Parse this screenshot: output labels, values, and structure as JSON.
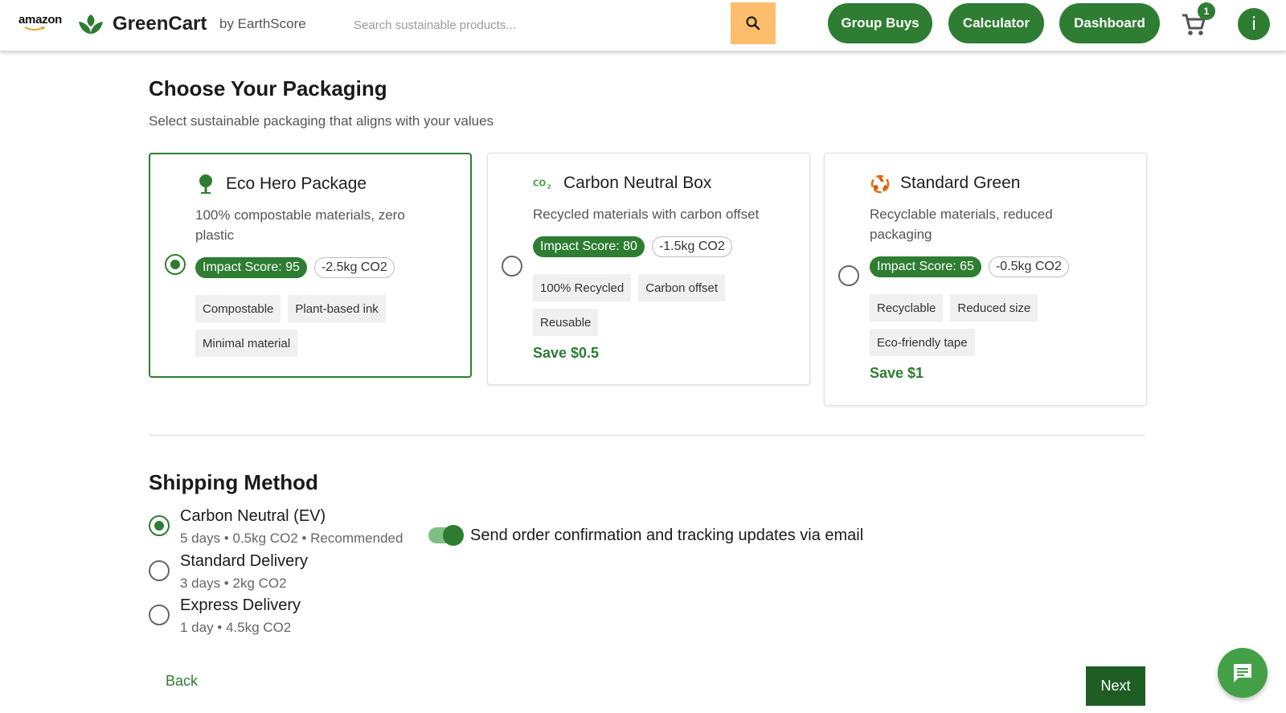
{
  "header": {
    "amazon_label": "amazon",
    "brand": "GreenCart",
    "brand_sub": "by EarthScore",
    "search_placeholder": "Search sustainable products...",
    "nav": [
      "Group Buys",
      "Calculator",
      "Dashboard"
    ],
    "cart_count": "1",
    "avatar_initial": "i"
  },
  "packaging": {
    "title": "Choose Your Packaging",
    "subtitle": "Select sustainable packaging that aligns with your values",
    "options": [
      {
        "icon": "tree-icon",
        "title": "Eco Hero Package",
        "desc": "100% compostable materials, zero plastic",
        "score": "Impact Score: 95",
        "co2": "-2.5kg CO2",
        "tags": [
          "Compostable",
          "Plant-based ink",
          "Minimal material"
        ],
        "save": "",
        "selected": true
      },
      {
        "icon": "co2-icon",
        "title": "Carbon Neutral Box",
        "desc": "Recycled materials with carbon offset",
        "score": "Impact Score: 80",
        "co2": "-1.5kg CO2",
        "tags": [
          "100% Recycled",
          "Carbon offset",
          "Reusable"
        ],
        "save": "Save $0.5",
        "selected": false
      },
      {
        "icon": "recycle-icon",
        "title": "Standard Green",
        "desc": "Recyclable materials, reduced packaging",
        "score": "Impact Score: 65",
        "co2": "-0.5kg CO2",
        "tags": [
          "Recyclable",
          "Reduced size",
          "Eco-friendly tape"
        ],
        "save": "Save $1",
        "selected": false
      }
    ]
  },
  "shipping": {
    "title": "Shipping Method",
    "methods": [
      {
        "label": "Carbon Neutral (EV)",
        "detail": "5 days • 0.5kg CO2 • Recommended",
        "selected": true
      },
      {
        "label": "Standard Delivery",
        "detail": "3 days • 2kg CO2",
        "selected": false
      },
      {
        "label": "Express Delivery",
        "detail": "1 day • 4.5kg CO2",
        "selected": false
      }
    ],
    "email_toggle_label": "Send order confirmation and tracking updates via email",
    "email_toggle_on": true
  },
  "footer": {
    "back_label": "Back",
    "next_label": "Next"
  },
  "colors": {
    "brand_green": "#2e7d32",
    "search_button": "#fdbd6c",
    "next_button": "#1e5e25",
    "chat_fab": "#43a047"
  }
}
